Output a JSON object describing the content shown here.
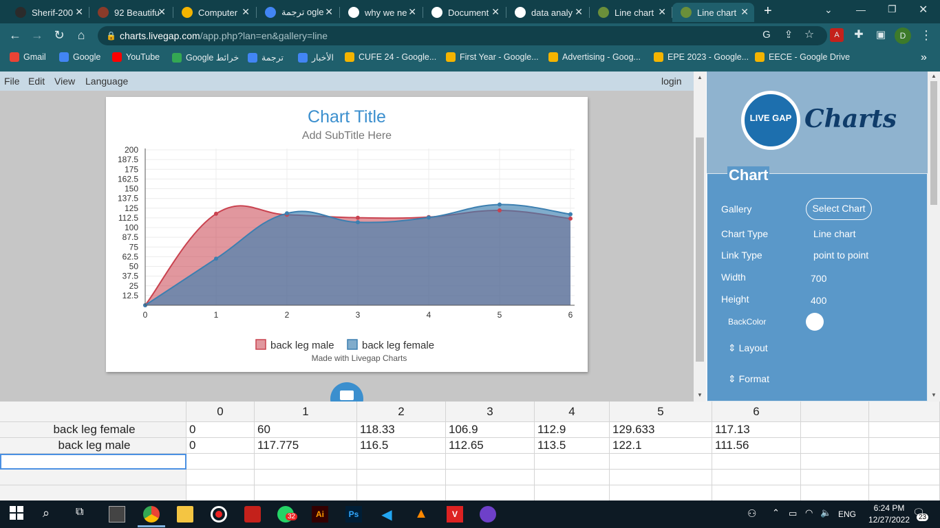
{
  "browser": {
    "tabs": [
      {
        "label": "Sherif-200",
        "fav_color": "#2b2b2b",
        "active": false
      },
      {
        "label": "92 Beautifu",
        "fav_color": "#8a3b2a",
        "active": false
      },
      {
        "label": "Computer",
        "fav_color": "#f4b400",
        "active": false
      },
      {
        "label": "ترجمة ogle",
        "fav_color": "#4285f4",
        "active": false
      },
      {
        "label": "why we ne",
        "fav_color": "#ffffff",
        "active": false
      },
      {
        "label": "Document",
        "fav_color": "#ffffff",
        "active": false
      },
      {
        "label": "data analy",
        "fav_color": "#ffffff",
        "active": false
      },
      {
        "label": "Line chart",
        "fav_color": "#6b8f3a",
        "active": false
      },
      {
        "label": "Line chart",
        "fav_color": "#6b8f3a",
        "active": true
      }
    ],
    "new_tab": "+",
    "url_domain": "charts.livegap.com",
    "url_path": "/app.php?lan=en&gallery=line",
    "profile_initial": "D",
    "bookmarks": [
      {
        "label": "Gmail",
        "color": "#ea4335"
      },
      {
        "label": "Google",
        "color": "#4285f4"
      },
      {
        "label": "YouTube",
        "color": "#ff0000"
      },
      {
        "label": "Google خرائط",
        "color": "#34a853"
      },
      {
        "label": "ترجمة",
        "color": "#4285f4"
      },
      {
        "label": "الأخبار",
        "color": "#4285f4"
      },
      {
        "label": "CUFE 24 - Google...",
        "color": "#f4b400"
      },
      {
        "label": "First Year - Google...",
        "color": "#f4b400"
      },
      {
        "label": "Advertising - Goog...",
        "color": "#f4b400"
      },
      {
        "label": "EPE 2023 - Google...",
        "color": "#f4b400"
      },
      {
        "label": "EECE - Google Drive",
        "color": "#f4b400"
      }
    ],
    "bookmarks_more": "»"
  },
  "app": {
    "menu": [
      "File",
      "Edit",
      "View",
      "Language"
    ],
    "login": "login",
    "logo_text": "Charts",
    "logo_badge": "LIVE GAP",
    "panel_title": "Chart",
    "settings": {
      "gallery_label": "Gallery",
      "gallery_button": "Select Chart",
      "chart_type_label": "Chart Type",
      "chart_type_value": "Line chart",
      "link_type_label": "Link Type",
      "link_type_value": "point to point",
      "width_label": "Width",
      "width_value": "700",
      "height_label": "Height",
      "height_value": "400",
      "backcolor_label": "BackColor",
      "backcolor_value": "#ffffff",
      "layout_label": "Layout",
      "format_label": "Format"
    },
    "save_icon": "floppy-disk-icon"
  },
  "chart_data": {
    "type": "area",
    "title": "Chart Title",
    "subtitle": "Add SubTitle Here",
    "footer": "Made with Livegap Charts",
    "x": [
      0,
      1,
      2,
      3,
      4,
      5,
      6
    ],
    "y_ticks": [
      "12.5",
      "25",
      "37.5",
      "50",
      "62.5",
      "75",
      "87.5",
      "100",
      "112.5",
      "125",
      "137.5",
      "150",
      "162.5",
      "175",
      "187.5",
      "200"
    ],
    "ylim": [
      0,
      200
    ],
    "grid": true,
    "legend_position": "bottom",
    "series": [
      {
        "name": "back leg male",
        "values": [
          0,
          117.775,
          116.5,
          112.65,
          113.5,
          122.1,
          111.56
        ],
        "color": "#c9424f",
        "fill": "rgba(201,66,79,0.55)"
      },
      {
        "name": "back leg female",
        "values": [
          0,
          60,
          118.33,
          106.9,
          112.9,
          129.633,
          117.13
        ],
        "color": "#3c7fb0",
        "fill": "rgba(60,127,176,0.65)"
      }
    ]
  },
  "sheet": {
    "columns": [
      "",
      "0",
      "1",
      "2",
      "3",
      "4",
      "5",
      "6",
      "",
      ""
    ],
    "rows": [
      [
        "back leg female",
        "0",
        "60",
        "118.33",
        "106.9",
        "112.9",
        "129.633",
        "117.13",
        "",
        ""
      ],
      [
        "back leg male",
        "0",
        "117.775",
        "116.5",
        "112.65",
        "113.5",
        "122.1",
        "111.56",
        "",
        ""
      ]
    ]
  },
  "taskbar": {
    "language": "ENG",
    "time": "6:24 PM",
    "date": "12/27/2022",
    "whatsapp_badge": "32",
    "notif_count": "23"
  }
}
